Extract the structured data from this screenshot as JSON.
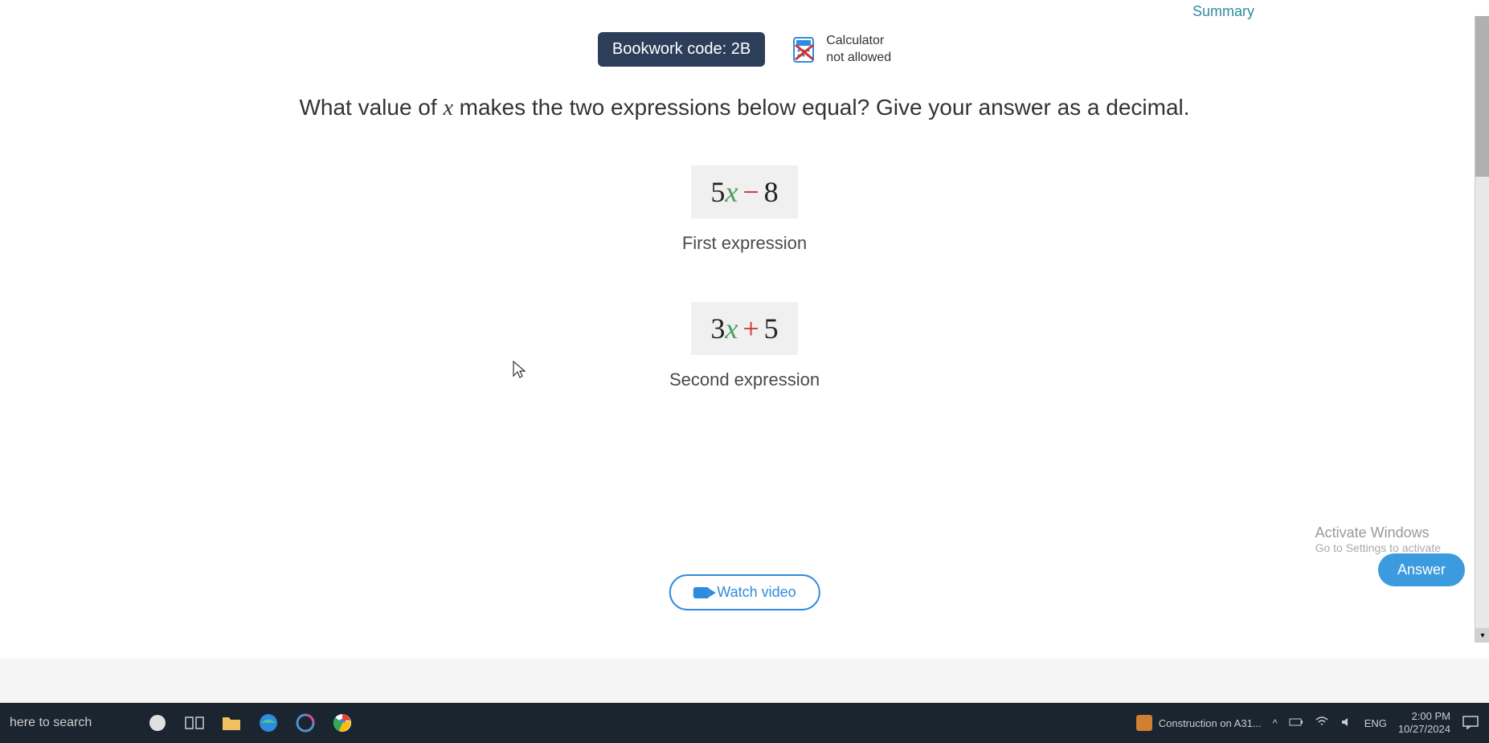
{
  "nav": {
    "summary_label": "Summary"
  },
  "header": {
    "bookwork_code": "Bookwork code: 2B",
    "calculator_line1": "Calculator",
    "calculator_line2": "not allowed"
  },
  "question": {
    "text_pre": "What value of ",
    "variable": "x",
    "text_post": " makes the two expressions below equal? Give your answer as a decimal."
  },
  "expressions": [
    {
      "coef": "5",
      "var": "x",
      "op": "−",
      "num": "8",
      "label": "First expression"
    },
    {
      "coef": "3",
      "var": "x",
      "op": "+",
      "num": "5",
      "label": "Second expression"
    }
  ],
  "buttons": {
    "watch_video": "Watch video",
    "answer": "Answer"
  },
  "windows_activation": {
    "title": "Activate Windows",
    "subtitle": "Go to Settings to activate"
  },
  "taskbar": {
    "search": "here to search",
    "news": "Construction on A31...",
    "lang": "ENG",
    "time": "2:00 PM",
    "date": "10/27/2024"
  }
}
